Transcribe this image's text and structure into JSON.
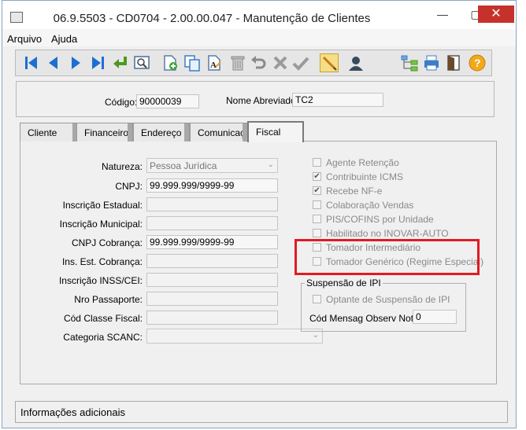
{
  "window": {
    "title": "06.9.5503 - CD0704 - 2.00.00.047 - Manutenção de Clientes",
    "minimize_glyph": "—",
    "maximize_glyph": "▢",
    "close_glyph": "✕"
  },
  "menu": {
    "items": [
      "Arquivo",
      "Ajuda"
    ]
  },
  "toolbar": {
    "buttons": [
      "first-record-icon",
      "previous-record-icon",
      "next-record-icon",
      "last-record-icon",
      "goto-icon",
      "preview-icon",
      "new-record-icon",
      "copy-record-icon",
      "edit-icon",
      "delete-icon",
      "undo-icon",
      "cancel-icon",
      "save-icon",
      "pencil-icon",
      "user-icon",
      "tree-icon",
      "print-icon",
      "exit-icon",
      "help-icon"
    ]
  },
  "header": {
    "codigo_label": "Código:",
    "codigo_value": "90000039",
    "nome_label": "Nome Abreviado:",
    "nome_value": "TC2"
  },
  "tabs": [
    "Cliente",
    "Financeiro",
    "Endereço",
    "Comunicaçã",
    "Fiscal"
  ],
  "fiscal": {
    "natureza_label": "Natureza:",
    "natureza_value": "Pessoa Jurídica",
    "cnpj_label": "CNPJ:",
    "cnpj_value": "99.999.999/9999-99",
    "ie_label": "Inscrição Estadual:",
    "ie_value": "",
    "im_label": "Inscrição Municipal:",
    "im_value": "",
    "cnpj_cob_label": "CNPJ Cobrança:",
    "cnpj_cob_value": "99.999.999/9999-99",
    "ie_cob_label": "Ins. Est. Cobrança:",
    "ie_cob_value": "",
    "inss_label": "Inscrição INSS/CEI:",
    "inss_value": "",
    "passaporte_label": "Nro Passaporte:",
    "passaporte_value": "",
    "classe_label": "Cód Classe Fiscal:",
    "classe_value": "",
    "scanc_label": "Categoria SCANC:",
    "scanc_value": ""
  },
  "checkboxes": [
    {
      "label": "Agente Retenção",
      "checked": false
    },
    {
      "label": "Contribuinte ICMS",
      "checked": true
    },
    {
      "label": "Recebe NF-e",
      "checked": true
    },
    {
      "label": "Colaboração Vendas",
      "checked": false
    },
    {
      "label": "PIS/COFINS por Unidade",
      "checked": false
    },
    {
      "label": "Habilitado no INOVAR-AUTO",
      "checked": false
    },
    {
      "label": "Tomador Intermediário",
      "checked": false
    },
    {
      "label": "Tomador Genérico (Regime Especial)",
      "checked": false
    }
  ],
  "check_glyph": "✔",
  "suspensao": {
    "title": "Suspensão de IPI",
    "optante_label": "Optante de Suspensão de IPI",
    "mensag_label": "Cód Mensag Observ Nota:",
    "mensag_value": "0"
  },
  "status": {
    "text": "Informações adicionais"
  },
  "colors": {
    "highlight": "#e01b24",
    "close_button": "#c7312b",
    "toolbar_blue": "#1d6fd1"
  }
}
